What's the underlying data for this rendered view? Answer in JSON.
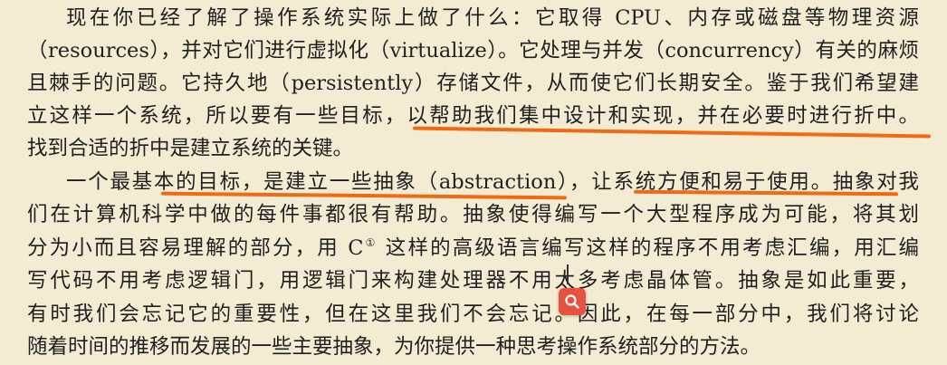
{
  "paragraph1": {
    "line1": "现在你已经了解了操作系统实际上做了什么：它取得 CPU、内存或磁盘等物理资源",
    "line2": "（resources），并对它们进行虚拟化（virtualize）。它处理与并发（concurrency）有关的麻烦",
    "line3": "且棘手的问题。它持久地（persistently）存储文件，从而使它们长期安全。鉴于我们希望建",
    "line4_a": "立这样一个系统，所以要有一些目标，",
    "line4_b": "以帮助我们集中设计和实现，并在必要时进行折中。",
    "line5": "找到合适的折中是建立系统的关键。"
  },
  "paragraph2": {
    "line1_a": "一个最基本",
    "line1_b": "的目标，是建立一些抽象（abstraction）",
    "line1_c": "，让系统",
    "line1_d": "方便和易于使用。抽象对我",
    "line2": "们在计算机科学中做的每件事都很有帮助。抽象使得编写一个大型程序成为可能，将其划",
    "line3_a": "分为小而且容易理解的部分，用 C",
    "line3_sup": "①",
    "line3_b": " 这样的高级语言编写这样的程序不用考虑汇编，用汇编",
    "line4": "写代码不用考虑逻辑门，用逻辑门来构建处理器不用太多考虑晶体管。抽象是如此重要，",
    "line5": "有时我们会忘记它的重要性，但在这里我们不会忘记。因此，在每一部分中，我们将讨论",
    "line6": "随着时间的推移而发展的一些主要抽象，为你提供一种思考操作系统部分的方法。"
  },
  "colors": {
    "background": "#f4ecd2",
    "highlight_underline": "#f06a13",
    "search_button": "#e8503f"
  },
  "icons": {
    "search": "search-icon"
  }
}
